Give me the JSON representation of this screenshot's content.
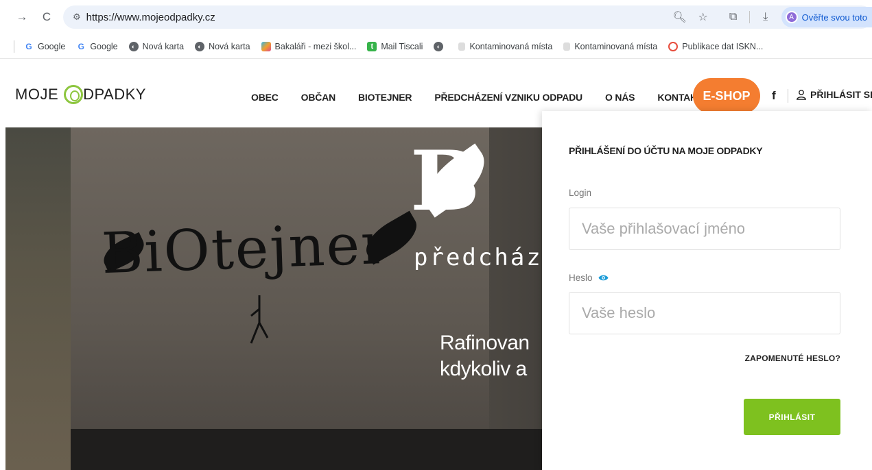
{
  "browser": {
    "url": "https://www.mojeodpadky.cz",
    "verify_label": "Ověřte svou toto",
    "verify_avatar": "A"
  },
  "bookmarks": [
    {
      "label": "Google",
      "icon": "google-icon"
    },
    {
      "label": "Google",
      "icon": "google-icon"
    },
    {
      "label": "Nová karta",
      "icon": "globe-icon"
    },
    {
      "label": "Nová karta",
      "icon": "globe-icon"
    },
    {
      "label": "Bakaláři - mezi škol...",
      "icon": "bakalari-icon"
    },
    {
      "label": "Mail Tiscali",
      "icon": "tiscali-icon"
    },
    {
      "label": "",
      "icon": "globe-icon"
    },
    {
      "label": "Kontaminovaná místa",
      "icon": "page-icon"
    },
    {
      "label": "Kontaminovaná místa",
      "icon": "page-icon"
    },
    {
      "label": "Publikace dat ISKN...",
      "icon": "iskn-icon"
    }
  ],
  "header": {
    "logo_left": "MOJE",
    "logo_right": "DPADKY",
    "nav": [
      "OBEC",
      "OBČAN",
      "BIOTEJNER",
      "PŘEDCHÁZENÍ VZNIKU ODPADU",
      "O NÁS",
      "KONTAKTY"
    ],
    "eshop": "E-SHOP",
    "facebook": "f",
    "login": "PŘIHLÁSIT SE"
  },
  "hero": {
    "script_text": "BiOtejner",
    "big_letter": "B",
    "subtitle": "předcház",
    "line1": "Rafinovan",
    "line2": "kdykoliv a"
  },
  "login_panel": {
    "title": "PŘIHLÁŠENÍ DO ÚČTU NA MOJE ODPADKY",
    "login_label": "Login",
    "login_placeholder": "Vaše přihlašovací jméno",
    "password_label": "Heslo",
    "password_placeholder": "Vaše heslo",
    "forgot": "ZAPOMENUTÉ HESLO?",
    "submit": "PŘIHLÁSIT"
  },
  "colors": {
    "accent_green": "#7ec11f",
    "eshop_orange": "#f47d30",
    "eye_blue": "#1a9bd7"
  }
}
